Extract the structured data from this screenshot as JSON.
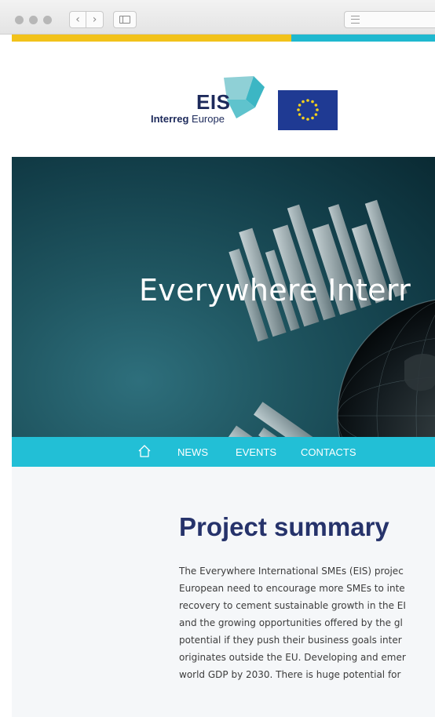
{
  "browser": {
    "back_label": "‹",
    "forward_label": "›"
  },
  "logo": {
    "name": "EIS",
    "subtitle_bold": "Interreg",
    "subtitle_rest": " Europe"
  },
  "hero": {
    "title": "Everywhere Interr"
  },
  "menu": {
    "items": [
      {
        "label": "NEWS"
      },
      {
        "label": "EVENTS"
      },
      {
        "label": "CONTACTS"
      }
    ]
  },
  "summary": {
    "title": "Project summary",
    "lines": [
      "The Everywhere International SMEs (EIS) projec",
      "European need to encourage more SMEs to inte",
      "recovery to cement sustainable growth in the EI",
      "and the growing opportunities offered by the gl",
      "potential if they push their business goals inter",
      "originates outside the EU. Developing and emer",
      "world GDP by 2030. There is huge potential for"
    ]
  },
  "colors": {
    "accent_yellow": "#f2c21a",
    "accent_cyan": "#1fb8cf",
    "menu_bg": "#22bfd6",
    "title_navy": "#26336b"
  }
}
